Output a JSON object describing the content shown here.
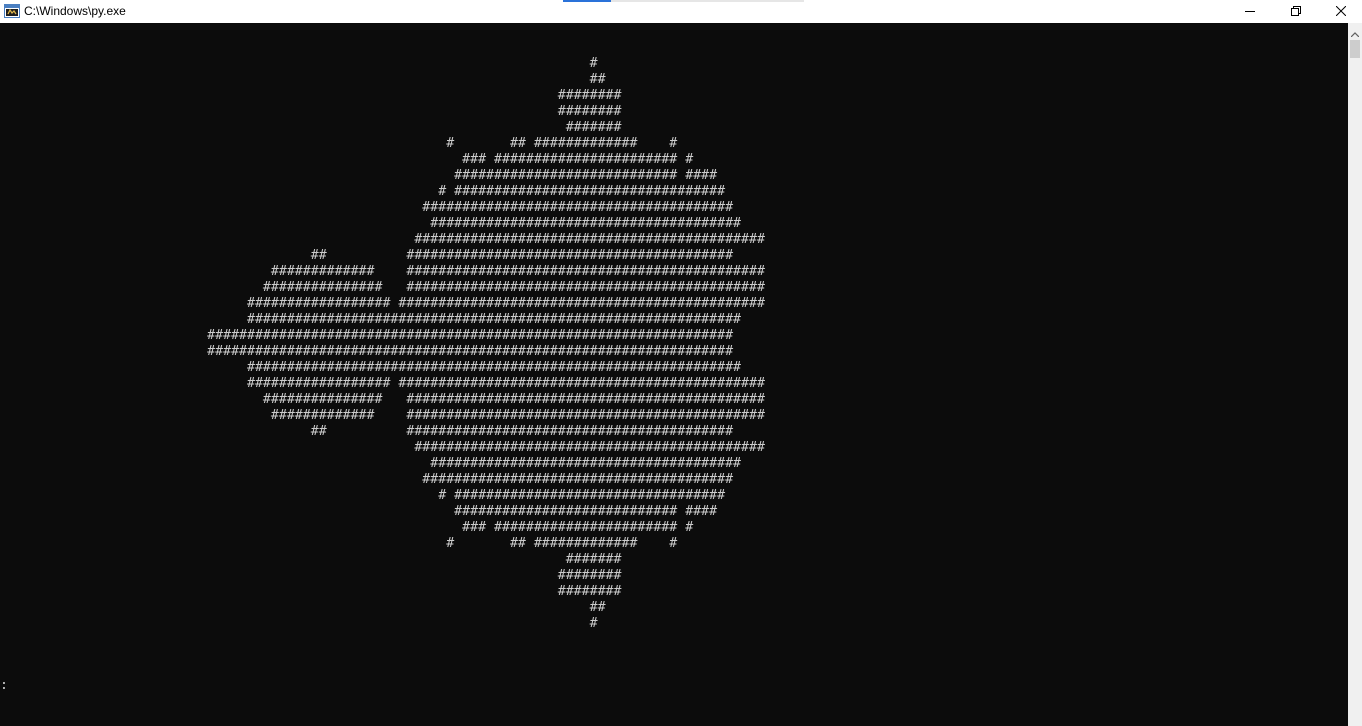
{
  "window": {
    "title": "C:\\Windows\\py.exe",
    "icon": "console-app-icon",
    "controls": [
      "minimize-icon",
      "restore-icon",
      "close-icon"
    ]
  },
  "console": {
    "background": "#0c0c0c",
    "foreground": "#cccccc",
    "output_lines": [
      "                                                                          #",
      "                                                                          ##",
      "                                                                      ########",
      "                                                                      ########",
      "                                                                       #######",
      "                                                        #       ## #############    #",
      "                                                          ### ####################### #",
      "                                                         ############################ ####",
      "                                                       # ##################################",
      "                                                     #######################################",
      "                                                      #######################################",
      "                                                    ############################################",
      "                                       ##          #########################################",
      "                                  #############    #############################################",
      "                                 ###############   #############################################",
      "                               ################## ##############################################",
      "                               ##############################################################",
      "                          ##################################################################",
      "                          ##################################################################",
      "                               ##############################################################",
      "                               ################## ##############################################",
      "                                 ###############   #############################################",
      "                                  #############    #############################################",
      "                                       ##          #########################################",
      "                                                    ############################################",
      "                                                      #######################################",
      "                                                     #######################################",
      "                                                       # ##################################",
      "                                                         ############################ ####",
      "                                                          ### ####################### #",
      "                                                        #       ## #############    #",
      "                                                                       #######",
      "                                                                      ########",
      "                                                                      ########",
      "                                                                          ##",
      "                                                                          #"
    ],
    "prompt": ":"
  }
}
